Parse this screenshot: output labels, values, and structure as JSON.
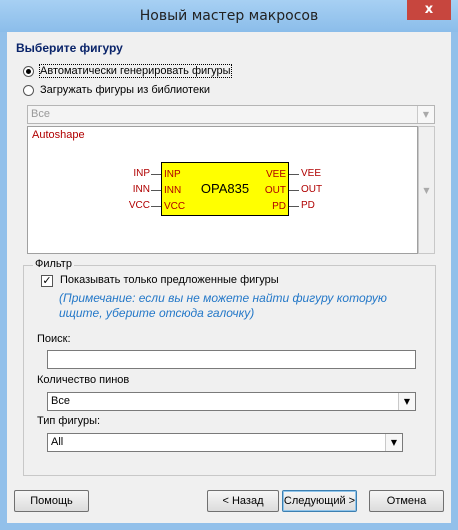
{
  "window": {
    "title": "Новый мастер макросов",
    "close_glyph": "x"
  },
  "heading": "Выберите фигуру",
  "radios": [
    {
      "label": "Автоматически генерировать фигуры",
      "selected": true
    },
    {
      "label": "Загружать фигуры из библиотеки",
      "selected": false
    }
  ],
  "library_combo": {
    "value": "Все",
    "enabled": false
  },
  "preview": {
    "caption": "Autoshape",
    "chip": {
      "name": "OPA835",
      "left_pins": [
        "INP",
        "INN",
        "VCC"
      ],
      "right_pins": [
        "VEE",
        "OUT",
        "PD"
      ]
    }
  },
  "filter": {
    "title": "Фильтр",
    "show_suggested_label": "Показывать только предложенные фигуры",
    "show_suggested_checked": true,
    "note": "(Примечание: если вы не можете найти фигуру которую ищите, уберите отсюда галочку)",
    "search_label": "Поиск:",
    "search_value": "",
    "pin_count_label": "Количество пинов",
    "pin_count_value": "Все",
    "shape_type_label": "Тип фигуры:",
    "shape_type_value": "All"
  },
  "buttons": {
    "help": "Помощь",
    "back": "< Назад",
    "next": "Следующий >",
    "cancel": "Отмена"
  },
  "colors": {
    "chip_fill": "#ffff00",
    "pin_text": "#b00000",
    "note_text": "#2478c8",
    "heading_text": "#0a246a"
  }
}
